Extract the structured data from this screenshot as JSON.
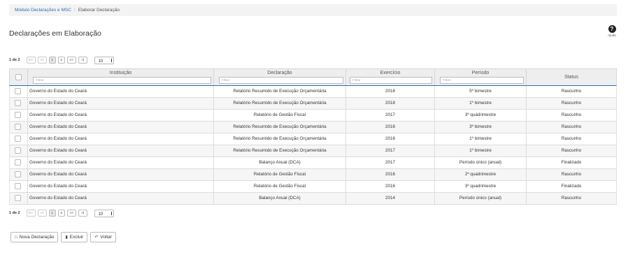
{
  "breadcrumb": {
    "items": [
      "Módulo Declarações e MSC",
      "Elaborar Declaração"
    ]
  },
  "title": "Declarações em Elaboração",
  "help": {
    "label": "Ajuda",
    "icon": "help-icon"
  },
  "pager_top": {
    "info": "1 de 2",
    "buttons": [
      "|<<",
      "<<",
      "1",
      "2",
      ">>",
      ">|"
    ],
    "page_size": "10"
  },
  "pager_bottom": {
    "info": "1 de 2",
    "buttons": [
      "|<<",
      "<<",
      "1",
      "2",
      ">>",
      ">|"
    ],
    "page_size": "10"
  },
  "table": {
    "columns": {
      "instituicao": "Instituição",
      "declaracao": "Declaração",
      "exercicio": "Exercício",
      "periodo": "Período",
      "status": "Status"
    },
    "filter_placeholder": "Filtrar",
    "rows": [
      {
        "instituicao": "Governo do Estado do Ceará",
        "declaracao": "Relatório Resumido de Execução Orçamentária",
        "exercicio": "2018",
        "periodo": "5º bimestre",
        "status": "Rascunho"
      },
      {
        "instituicao": "Governo do Estado do Ceará",
        "declaracao": "Relatório Resumido de Execução Orçamentária",
        "exercicio": "2018",
        "periodo": "1º bimestre",
        "status": "Rascunho"
      },
      {
        "instituicao": "Governo do Estado do Ceará",
        "declaracao": "Relatório de Gestão Fiscal",
        "exercicio": "2017",
        "periodo": "3º quadrimestre",
        "status": "Rascunho"
      },
      {
        "instituicao": "Governo do Estado do Ceará",
        "declaracao": "Relatório Resumido de Execução Orçamentária",
        "exercicio": "2016",
        "periodo": "3º bimestre",
        "status": "Rascunho"
      },
      {
        "instituicao": "Governo do Estado do Ceará",
        "declaracao": "Relatório Resumido de Execução Orçamentária",
        "exercicio": "2016",
        "periodo": "1º bimestre",
        "status": "Rascunho"
      },
      {
        "instituicao": "Governo do Estado do Ceará",
        "declaracao": "Relatório Resumido de Execução Orçamentária",
        "exercicio": "2017",
        "periodo": "1º bimestre",
        "status": "Rascunho"
      },
      {
        "instituicao": "Governo do Estado do Ceará",
        "declaracao": "Balanço Anual (DCA)",
        "exercicio": "2017",
        "periodo": "Período único (anual)",
        "status": "Finalizado"
      },
      {
        "instituicao": "Governo do Estado do Ceará",
        "declaracao": "Relatório de Gestão Fiscal",
        "exercicio": "2016",
        "periodo": "2º quadrimestre",
        "status": "Rascunho"
      },
      {
        "instituicao": "Governo do Estado do Ceará",
        "declaracao": "Relatório de Gestão Fiscal",
        "exercicio": "2016",
        "periodo": "3º quadrimestre",
        "status": "Finalizado"
      },
      {
        "instituicao": "Governo do Estado do Ceará",
        "declaracao": "Balanço Anual (DCA)",
        "exercicio": "2014",
        "periodo": "Período único (anual)",
        "status": "Rascunho"
      }
    ]
  },
  "actions": {
    "new": {
      "label": "Nova Declaração",
      "icon": "document-icon"
    },
    "delete": {
      "label": "Excluir",
      "icon": "trash-icon"
    },
    "back": {
      "label": "Voltar",
      "icon": "undo-arrow-icon"
    }
  },
  "colors": {
    "link": "#2a6db5",
    "header_bg": "#eeeeee",
    "header_underline": "#2a6db5",
    "alt_row": "#f6f6f6"
  }
}
